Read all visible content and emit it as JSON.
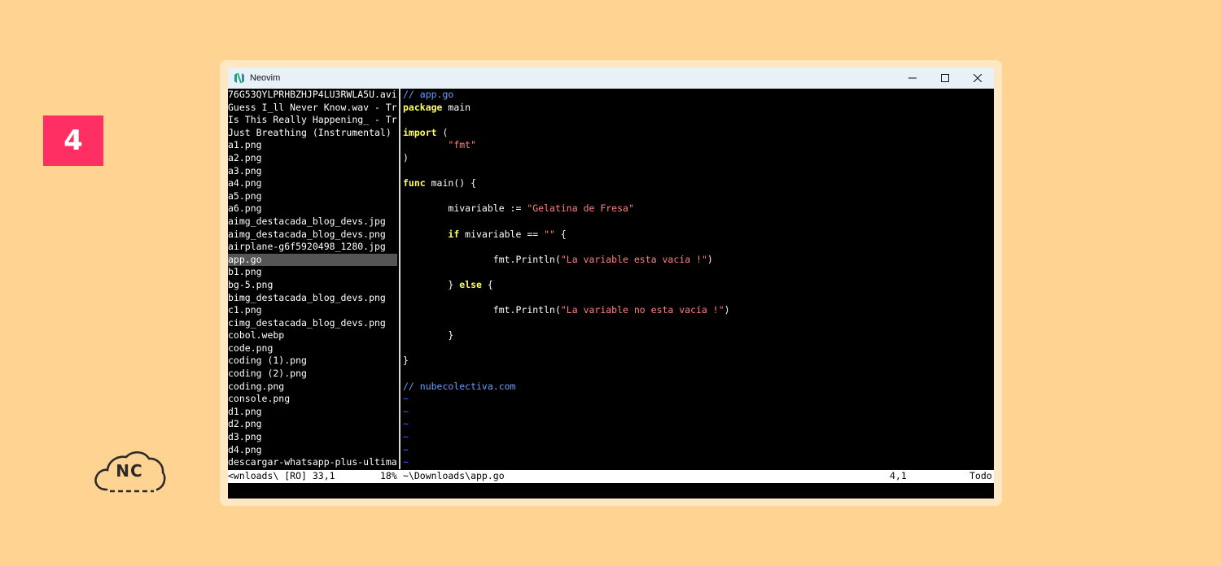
{
  "badge": {
    "number": "4"
  },
  "logo": {
    "text": "NC"
  },
  "window": {
    "title": "Neovim",
    "icon": "neovim-icon",
    "controls": [
      "minimize-icon",
      "maximize-icon",
      "close-icon"
    ]
  },
  "file_list": [
    "76G53QYLPRHBZHJP4LU3RWLA5U.avi",
    "Guess I_ll Never Know.wav - Tr",
    "Is This Really Happening_ - Tr",
    "Just Breathing (Instrumental)",
    "a1.png",
    "a2.png",
    "a3.png",
    "a4.png",
    "a5.png",
    "a6.png",
    "aimg_destacada_blog_devs.jpg",
    "aimg_destacada_blog_devs.png",
    "airplane-g6f5920498_1280.jpg",
    "app.go",
    "b1.png",
    "bg-5.png",
    "bimg_destacada_blog_devs.png",
    "c1.png",
    "cimg_destacada_blog_devs.png",
    "cobol.webp",
    "code.png",
    "coding (1).png",
    "coding (2).png",
    "coding.png",
    "console.png",
    "d1.png",
    "d2.png",
    "d3.png",
    "d4.png",
    "descargar-whatsapp-plus-ultima"
  ],
  "selected_file": "app.go",
  "code": {
    "c1": "// app.go",
    "l2kw": "package",
    "l2rest": " main",
    "l4kw": "import",
    "l4rest": " (",
    "l5str": "\"fmt\"",
    "l6": ")",
    "l8kw": "func",
    "l8rest": " main() {",
    "l10a": "mivariable := ",
    "l10str": "\"Gelatina de Fresa\"",
    "l12kw": "if",
    "l12a": " mivariable == ",
    "l12str": "\"\"",
    "l12b": " {",
    "l14a": "fmt.Println(",
    "l14str": "\"La variable esta vacía !\"",
    "l14b": ")",
    "l16a": "} ",
    "l16kw": "else",
    "l16b": " {",
    "l18a": "fmt.Println(",
    "l18str": "\"La variable no esta vacía !\"",
    "l18b": ")",
    "l20": "}",
    "l22": "}",
    "c2": "// nubecolectiva.com",
    "tilde": "~"
  },
  "status": {
    "left": "<wnloads\\ [RO] 33,1",
    "left_pct": "18%",
    "right_file": "~\\Downloads\\app.go",
    "right_pos": "4,1",
    "right_todo": "Todo"
  },
  "colors": {
    "background": "#ffd493",
    "badge": "#ff2e63",
    "keyword": "#ffff60",
    "string": "#ff8080",
    "comment": "#6b9bff"
  }
}
